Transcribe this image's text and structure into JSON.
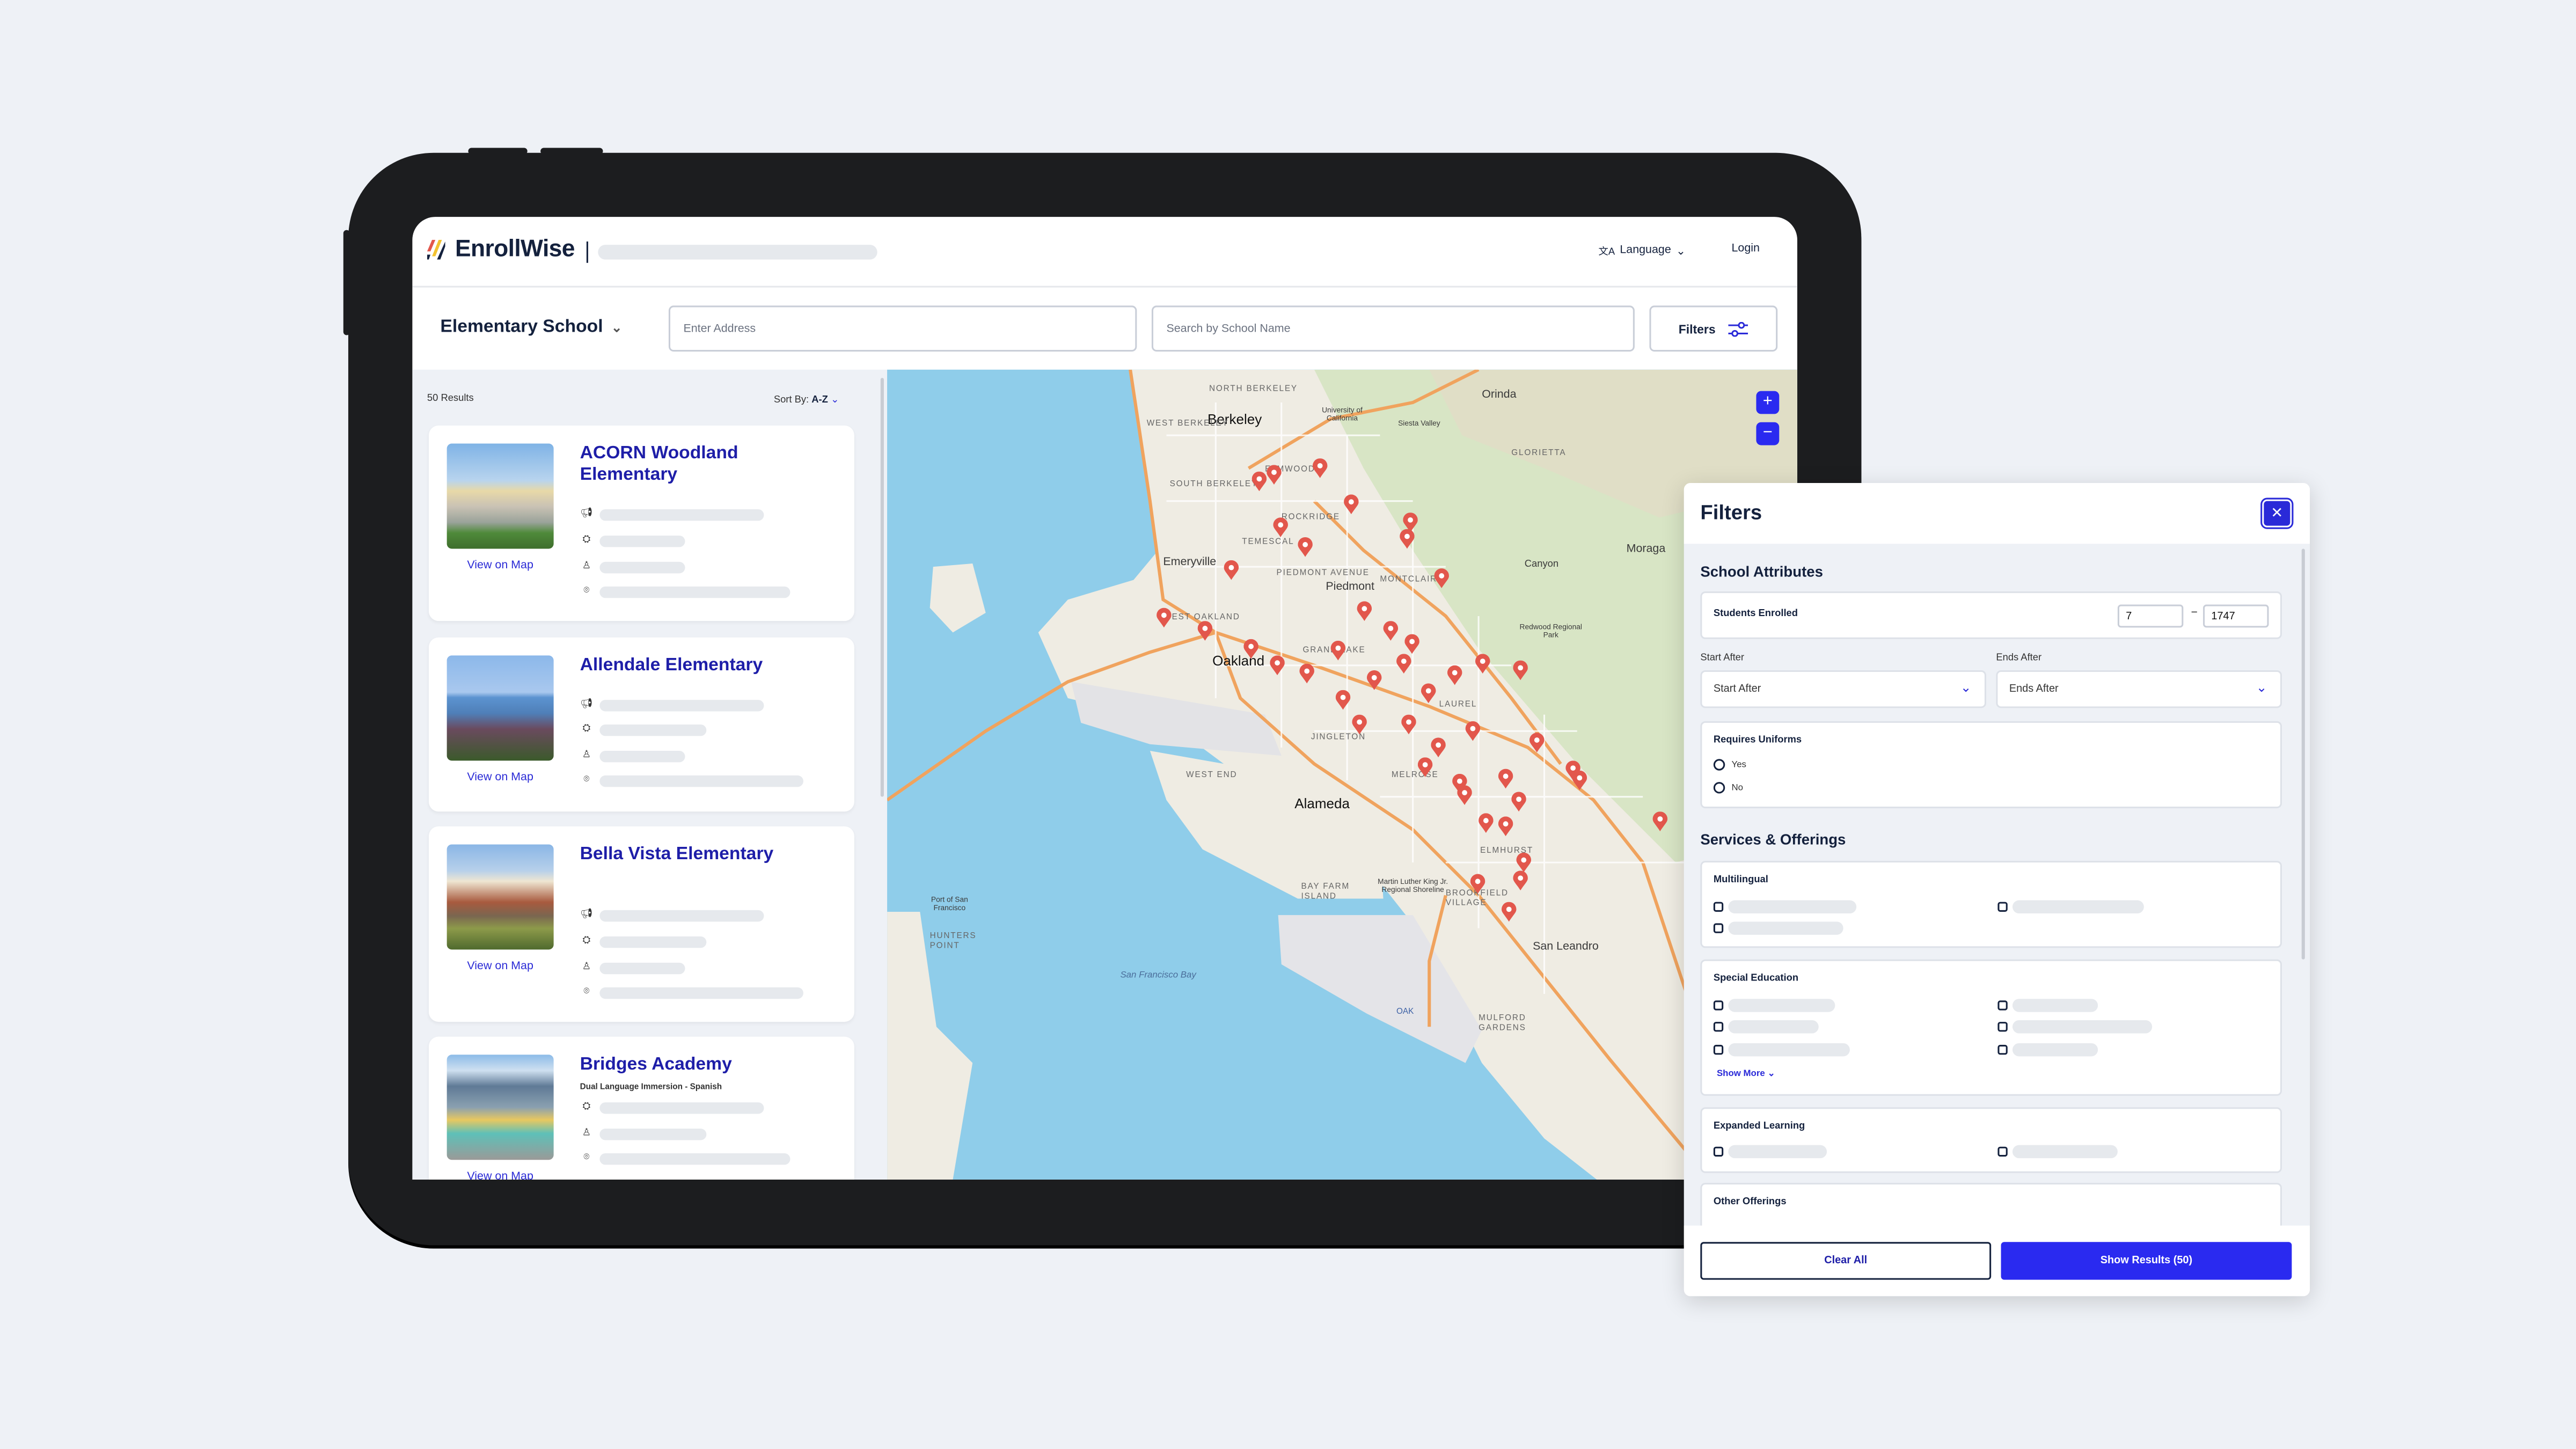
{
  "header": {
    "brand": "EnrollWise",
    "language_label": "Language",
    "login_label": "Login"
  },
  "search_bar": {
    "school_level": "Elementary School",
    "address_placeholder": "Enter Address",
    "school_name_placeholder": "Search by School Name",
    "filters_label": "Filters"
  },
  "results": {
    "count_label": "50 Results",
    "sort_prefix": "Sort By:",
    "sort_value": "A-Z",
    "view_on_map_label": "View on Map",
    "schools": [
      {
        "name": "ACORN Woodland Elementary"
      },
      {
        "name": "Allendale Elementary"
      },
      {
        "name": "Bella Vista Elementary"
      },
      {
        "name": "Bridges Academy",
        "program": "Dual Language Immersion - Spanish"
      }
    ]
  },
  "map": {
    "zoom_in": "+",
    "zoom_out": "−",
    "labels": [
      "Berkeley",
      "Oakland",
      "Alameda",
      "Emeryville",
      "Piedmont",
      "San Leandro",
      "Orinda",
      "Moraga",
      "Canyon",
      "NORTH BERKELEY",
      "WEST BERKELEY",
      "SOUTH BERKELEY",
      "ELMWOOD",
      "ROCKRIDGE",
      "TEMESCAL",
      "PIEDMONT AVENUE",
      "MONTCLAIR",
      "GRAND LAKE",
      "WEST OAKLAND",
      "JINGLETON",
      "WEST END",
      "MELROSE",
      "LAUREL",
      "ELMHURST",
      "BROOKFIELD VILLAGE",
      "BAY FARM ISLAND",
      "MULFORD GARDENS",
      "HUNTERS POINT",
      "GLORIETTA",
      "San Francisco Bay",
      "University of California",
      "Siesta Valley",
      "Redwood Regional Park",
      "Martin Luther King Jr. Regional Shoreline",
      "Port of San Francisco",
      "OAK"
    ],
    "pin_color": "#e2574c",
    "water_color": "#8fcdea"
  },
  "filters": {
    "title": "Filters",
    "school_attributes": {
      "heading": "School Attributes",
      "students_enrolled_label": "Students Enrolled",
      "min": "7",
      "max": "1747",
      "range_separator": "–",
      "start_after_label": "Start After",
      "start_after_value": "Start After",
      "ends_after_label": "Ends After",
      "ends_after_value": "Ends After",
      "uniforms_label": "Requires Uniforms",
      "yes": "Yes",
      "no": "No"
    },
    "services": {
      "heading": "Services & Offerings",
      "multilingual": "Multilingual",
      "special_education": "Special Education",
      "show_more": "Show More",
      "expanded_learning": "Expanded Learning",
      "other_offerings": "Other Offerings"
    },
    "clear_all": "Clear All",
    "show_results": "Show Results (50)"
  },
  "colors": {
    "brand_blue": "#2a2af0",
    "title_blue": "#1e1ea8",
    "navy": "#14213d"
  }
}
